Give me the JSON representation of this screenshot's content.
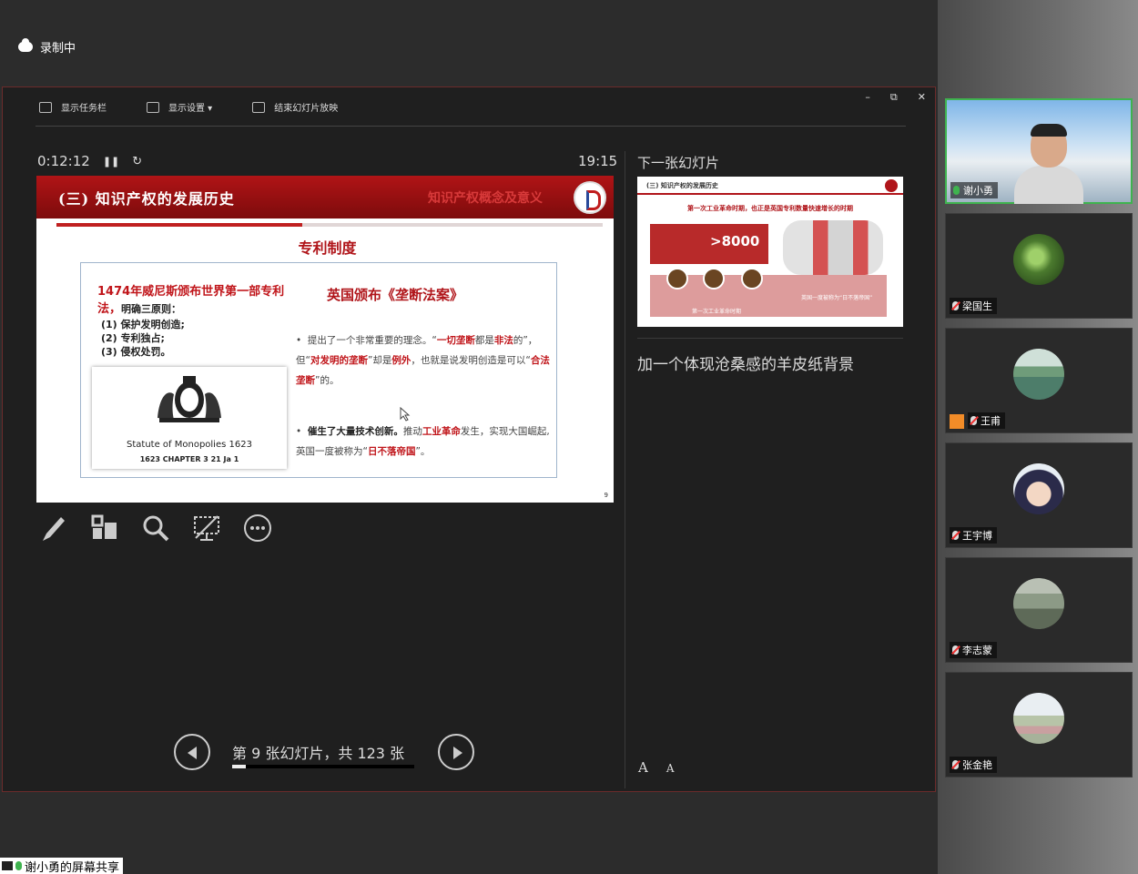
{
  "recording": {
    "label": "录制中"
  },
  "presenter": {
    "toolbar": {
      "taskbar": "显示任务栏",
      "display": "显示设置 ▾",
      "end": "结束幻灯片放映"
    },
    "window_controls": {
      "min": "–",
      "max": "⧉",
      "close": "✕"
    },
    "elapsed": "0:12:12",
    "clock": "19:15",
    "next_label": "下一张幻灯片",
    "notes": "加一个体现沧桑感的羊皮纸背景",
    "nav_text": "第 9 张幻灯片，共 123 张",
    "progress": 0.073,
    "font_up": "A",
    "font_down": "A"
  },
  "slide": {
    "title": "(三) 知识产权的发展历史",
    "watermark": "知识产权概念及意义",
    "subtitle": "专利制度",
    "law_line": "1474年威尼斯颁布世界第一部专利法，",
    "law_tail": "明确三原则：",
    "principles": [
      "(1) 保护发明创造;",
      "(2) 专利独占;",
      "(3) 侵权处罚。"
    ],
    "img_caption1": "Statute of Monopolies 1623",
    "img_caption2": "1623 CHAPTER 3 21 Ja 1",
    "heading": "英国颁布《垄断法案》",
    "bullet1_a": "提出了一个非常重要的理念。“",
    "bullet1_b": "一切垄断",
    "bullet1_c": "都是",
    "bullet1_d": "非法",
    "bullet1_e": "的”，但“",
    "bullet1_f": "对发明的垄断",
    "bullet1_g": "”却是",
    "bullet1_h": "例外",
    "bullet1_i": "，也就是说发明创造是可以“",
    "bullet1_j": "合法垄断",
    "bullet1_k": "”的。",
    "bullet2_a": "催生了大量技术创新。",
    "bullet2_b": "推动",
    "bullet2_c": "工业革命",
    "bullet2_d": "发生，实现大国崛起,英国一度被称为“",
    "bullet2_e": "日不落帝国",
    "bullet2_f": "”。",
    "page_num": "9"
  },
  "next_slide": {
    "title": "(三) 知识产权的发展历史",
    "subtitle": "第一次工业革命时期，也正是英国专利数量快速增长的时期",
    "big_number": ">8000",
    "cap1": "第一次工业革命时期",
    "cap2": "英国一度被称为“日不落帝国”"
  },
  "participants": [
    {
      "name": "谢小勇",
      "mic": "on",
      "active": true
    },
    {
      "name": "梁国生",
      "mic": "off"
    },
    {
      "name": "王甫",
      "mic": "off",
      "host": true
    },
    {
      "name": "王宇博",
      "mic": "off"
    },
    {
      "name": "李志蒙",
      "mic": "off"
    },
    {
      "name": "张金艳",
      "mic": "off"
    }
  ],
  "share_label": "谢小勇的屏幕共享",
  "colors": {
    "accent_red": "#b0151a",
    "mic_green": "#3fb34f"
  }
}
